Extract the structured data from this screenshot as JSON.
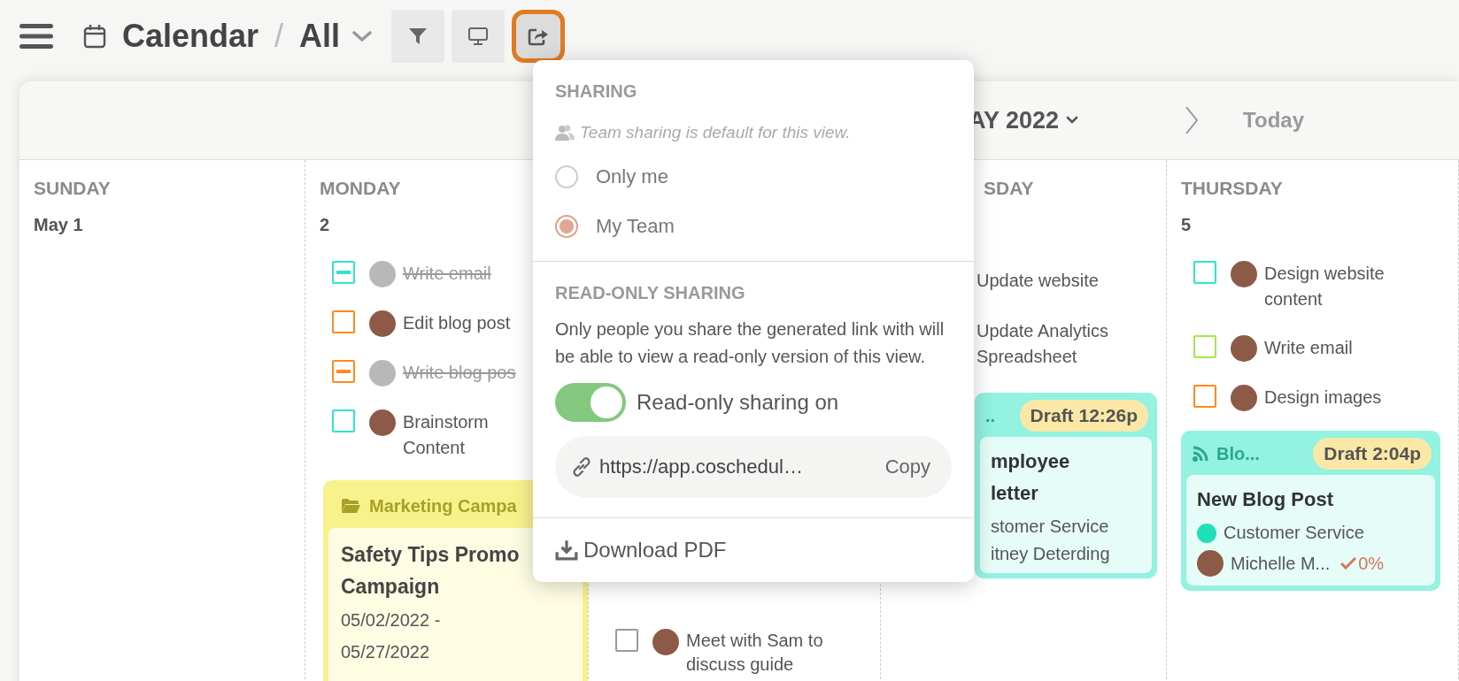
{
  "toolbar": {
    "title": "Calendar",
    "separator": "/",
    "view": "All",
    "buttons": [
      {
        "kind": "filter",
        "selected": false
      },
      {
        "kind": "display",
        "selected": false
      },
      {
        "kind": "share",
        "selected": true
      }
    ]
  },
  "calendar": {
    "month": "AY 2022",
    "today": "Today",
    "days": [
      {
        "weekday": "SUNDAY",
        "date": "May 1"
      },
      {
        "weekday": "MONDAY",
        "date": "2",
        "tasks": [
          {
            "text": "Write email",
            "color": "#2ee6c8",
            "done": true,
            "avatar": true
          },
          {
            "text": "Edit blog post",
            "color": "#ff8a1e",
            "done": false,
            "avatar": true
          },
          {
            "text": "Write blog pos",
            "color": "#ff8a1e",
            "done": true,
            "avatar": true
          },
          {
            "text": "Brainstorm Content",
            "color": "#2ee6c8",
            "done": false,
            "avatar": true
          }
        ],
        "cards": [
          {
            "kind": "campaign",
            "label": "Marketing Campa",
            "title": "Safety Tips Promo Campaign",
            "dates": "05/02/2022 - 05/27/2022"
          }
        ]
      },
      {
        "tasks": [
          {
            "text": "Meet with Sam to discuss guide",
            "color": "#9a9a9a",
            "done": false,
            "avatar": true
          }
        ]
      },
      {
        "weekday": "SDAY",
        "tasks": [
          {
            "text": "Update website",
            "avatar": false
          },
          {
            "text": "Update Analytics Spreadsheet",
            "avatar": false
          }
        ],
        "cards": [
          {
            "kind": "post",
            "label": "..",
            "status": "Draft 12:26p",
            "title": "mployee letter",
            "category": "stomer Service",
            "person": "itney Deterding"
          }
        ]
      },
      {
        "weekday": "THURSDAY",
        "date": "5",
        "tasks": [
          {
            "text": "Design website content",
            "color": "#2ee6c8",
            "done": false,
            "avatar": true
          },
          {
            "text": "Write email",
            "color": "#a6e64e",
            "done": false,
            "avatar": true
          },
          {
            "text": "Design images",
            "color": "#ff8a1e",
            "done": false,
            "avatar": true
          }
        ],
        "cards": [
          {
            "kind": "post",
            "label": "Blo...",
            "status": "Draft 2:04p",
            "title": "New Blog Post",
            "category": "Customer Service",
            "color": "#1fe0b8",
            "person": "Michelle M...",
            "avatar": true,
            "progress": "0%"
          }
        ]
      }
    ]
  },
  "sharing_menu": {
    "heading": "SHARING",
    "note": "Team sharing is default for this view.",
    "options": [
      {
        "label": "Only me",
        "selected": false
      },
      {
        "label": "My Team",
        "selected": true
      }
    ],
    "read_only_heading": "READ-ONLY SHARING",
    "description": "Only people you share the generated link with will be able to view a read-only version of this view.",
    "toggle": {
      "label": "Read-only sharing on",
      "on": true
    },
    "link": {
      "url": "https://app.coschedul…",
      "button": "Copy"
    },
    "download": "Download PDF"
  }
}
